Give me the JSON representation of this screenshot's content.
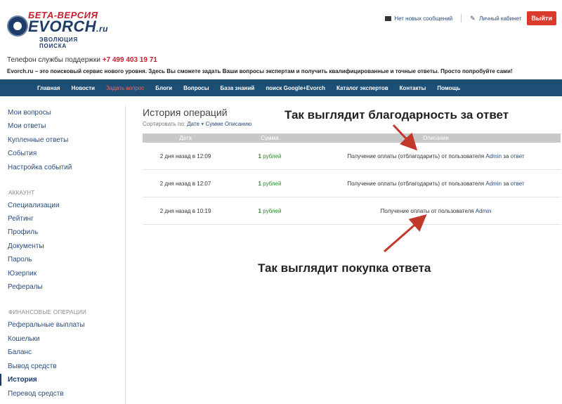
{
  "logo": {
    "beta": "БЕТА-ВЕРСИЯ",
    "brand": "EVORCH",
    "tld": ".ru",
    "slogan": "ЭВОЛЮЦИЯ ПОИСКА"
  },
  "topbar": {
    "messages": "Нет новых сообщений",
    "cabinet": "Личный кабинет",
    "logout": "Выйти"
  },
  "support": {
    "label": "Телефон службы поддержки",
    "phone": "+7 499 403 19 71"
  },
  "tagline": "Evorch.ru – это поисковый сервис нового уровня. Здесь Вы сможете задать Ваши вопросы экспертам и получить квалифицированные и точные ответы. Просто попробуйте сами!",
  "nav": [
    "Главная",
    "Новости",
    "Задать вопрос",
    "Блоги",
    "Вопросы",
    "База знаний",
    "поиск Google+Evorch",
    "Каталог экспертов",
    "Контакты",
    "Помощь"
  ],
  "sidebar": {
    "group1": [
      "Мои вопросы",
      "Мои ответы",
      "Купленные ответы",
      "События",
      "Настройка событий"
    ],
    "account_header": "АККАУНТ",
    "group2": [
      "Специализации",
      "Рейтинг",
      "Профиль",
      "Документы",
      "Пароль",
      "Юзерпик",
      "Рефералы"
    ],
    "finance_header": "ФИНАНСОВЫЕ ОПЕРАЦИИ",
    "group3": [
      "Реферальные выплаты",
      "Кошельки",
      "Баланс",
      "Вывод средств",
      "История",
      "Перевод средств"
    ]
  },
  "main": {
    "title": "История операций",
    "sort_label": "Сортировать по:",
    "sort_date": "Дате",
    "sort_sum": "Сумме",
    "sort_desc": "Описанию",
    "columns": [
      "Дата",
      "Сумма",
      "Описание"
    ],
    "rows": [
      {
        "date": "2 дня назад в 12:09",
        "amount": "1",
        "unit": "рублей",
        "desc": "Получение оплаты (отблагодарить) от пользователя",
        "user": "Admin",
        "mid": "за",
        "link": "ответ"
      },
      {
        "date": "2 дня назад в 12:07",
        "amount": "1",
        "unit": "рублей",
        "desc": "Получение оплаты (отблагодарить) от пользователя",
        "user": "Admin",
        "mid": "за",
        "link": "ответ"
      },
      {
        "date": "2 дня назад в 10:19",
        "amount": "1",
        "unit": "рублей",
        "desc": "Получение оплаты от пользователя",
        "user": "Admin",
        "mid": "",
        "link": ""
      }
    ]
  },
  "annotations": {
    "thanks": "Так выглядит благодарность за ответ",
    "purchase": "Так выглядит покупка ответа"
  },
  "colors": {
    "nav_bg": "#1d4f75",
    "accent_red": "#d93a2b",
    "arrow": "#c0392b",
    "money_green": "#2f8a2f"
  }
}
